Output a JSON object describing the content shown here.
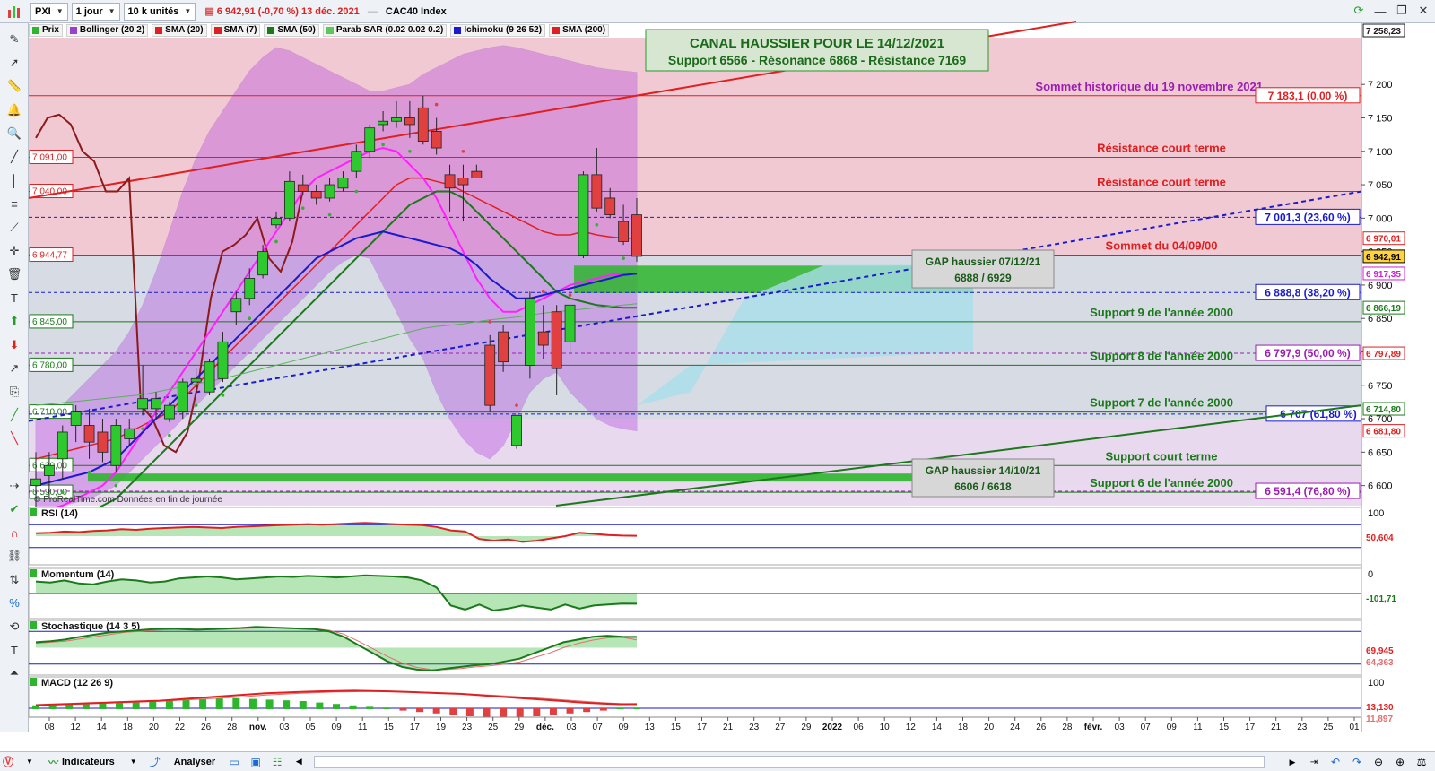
{
  "topbar": {
    "symbol": "PXI",
    "interval": "1 jour",
    "units": "10 k unités",
    "quote": "6 942,91 (-0,70 %) 13 déc. 2021",
    "instrument": "CAC40 Index"
  },
  "indicators": [
    {
      "label": "Prix",
      "color": "#2db52d"
    },
    {
      "label": "Bollinger (20 2)",
      "color": "#9a3fd0"
    },
    {
      "label": "SMA (20)",
      "color": "#e02020"
    },
    {
      "label": "SMA (7)",
      "color": "#e02020"
    },
    {
      "label": "SMA (50)",
      "color": "#1a7a1a"
    },
    {
      "label": "Parab SAR (0.02 0.02 0.2)",
      "color": "#5cc85c"
    },
    {
      "label": "Ichimoku (9 26 52)",
      "color": "#1a1ad0"
    },
    {
      "label": "SMA (200)",
      "color": "#e02020"
    }
  ],
  "toolbar": {
    "tools": [
      "pen-icon",
      "cursor-icon",
      "ruler-icon",
      "alarm-icon",
      "zoom-icon",
      "line-icon",
      "vertical-line-icon",
      "fibonacci-icon",
      "fan-icon",
      "crosshair-icon",
      "trash-icon",
      "text-icon",
      "up-arrow-icon",
      "down-arrow-icon",
      "arrow-icon",
      "copy-icon",
      "trend-up-icon",
      "trend-down-icon",
      "ray-icon",
      "horizontal-ray-icon",
      "check-icon",
      "magnet-icon",
      "link-icon",
      "scale-icon",
      "percent-icon",
      "rewind-icon",
      "text-box-icon",
      "up-icon"
    ]
  },
  "bottombar": {
    "indicators_label": "Indicateurs",
    "analyze_label": "Analyser"
  },
  "colors": {
    "bull": "#2ec92e",
    "bear": "#e04040",
    "resistance": "#e02020",
    "support": "#1a7a1a",
    "fibo": "#1a1ad0",
    "annotation_purple": "#9a1fb0",
    "channel": "#e02020"
  },
  "chart_data": {
    "type": "candlestick",
    "title_box": {
      "line1": "CANAL HAUSSIER POUR LE 14/12/2021",
      "line2": "Support 6566 - Résonance 6868 - Résistance 7169"
    },
    "attribution": "© ProRealTime.com  Données en fin de journée",
    "price_axis": {
      "ylim": [
        6570,
        7270
      ],
      "ticks": [
        6600,
        6650,
        6700,
        6750,
        6800,
        6850,
        6900,
        6950,
        7000,
        7050,
        7100,
        7150,
        7200,
        7258.23
      ],
      "tick_labels": [
        "6 600",
        "6 650",
        "6 700",
        "6 750",
        "6 800",
        "6 850",
        "6 900",
        "6 950",
        "7 000",
        "7 050",
        "7 100",
        "7 150",
        "7 200",
        "7 258,23"
      ],
      "right_badges": [
        {
          "text": "7 258,23",
          "price": 7258.23,
          "color": "#1a1a1a"
        },
        {
          "text": "6 970,01",
          "price": 6970.01,
          "color": "#e02020"
        },
        {
          "text": "6 942,91",
          "price": 6942.91,
          "color": "#000000",
          "bg": "#ffd23f"
        },
        {
          "text": "6 917,35",
          "price": 6917.35,
          "color": "#d020d0"
        },
        {
          "text": "6 866,19",
          "price": 6866.19,
          "color": "#1a7a1a"
        },
        {
          "text": "6 797,89",
          "price": 6797.89,
          "color": "#e02020"
        },
        {
          "text": "6 714,80",
          "price": 6714.8,
          "color": "#1a7a1a"
        },
        {
          "text": "6 681,80",
          "price": 6681.8,
          "color": "#e02020"
        }
      ]
    },
    "x_axis": {
      "tick_labels": [
        "08",
        "12",
        "14",
        "18",
        "20",
        "22",
        "26",
        "28",
        "nov.",
        "03",
        "05",
        "09",
        "11",
        "15",
        "17",
        "19",
        "23",
        "25",
        "29",
        "déc.",
        "03",
        "07",
        "09",
        "13",
        "15",
        "17",
        "21",
        "23",
        "27",
        "29",
        "2022",
        "06",
        "10",
        "12",
        "14",
        "18",
        "20",
        "24",
        "26",
        "28",
        "févr.",
        "03",
        "07",
        "09",
        "11",
        "15",
        "17",
        "21",
        "23",
        "25",
        "01"
      ]
    },
    "horizontal_levels": [
      {
        "price": 7183.1,
        "label": "Sommet historique du 19 novembre 2021",
        "value_label": "7 183,1 (0,00 %)",
        "color": "#e02020"
      },
      {
        "price": 7091.0,
        "left_label": "7 091,00",
        "label": "Résistance court terme",
        "color": "#e02020"
      },
      {
        "price": 7040.0,
        "left_label": "7 040,00",
        "label": "Résistance court terme",
        "color": "#e02020"
      },
      {
        "price": 7001.3,
        "value_label": "7 001,3 (23,60 %)",
        "color": "#1a1ad0",
        "dashed": true
      },
      {
        "price": 6944.77,
        "left_label": "6 944,77",
        "label": "Sommet du 04/09/00",
        "color": "#e02020"
      },
      {
        "price": 6888.8,
        "value_label": "6 888,8 (38,20 %)",
        "color": "#1a1ad0",
        "dashed": true
      },
      {
        "price": 6845.0,
        "left_label": "6 845,00",
        "label": "Support 9 de l'année 2000",
        "color": "#1a7a1a"
      },
      {
        "price": 6797.9,
        "value_label": "6 797,9 (50,00 %)",
        "color": "#9a1fb0",
        "dashed": true
      },
      {
        "price": 6780.0,
        "left_label": "6 780,00",
        "label": "Support 8 de l'année 2000",
        "color": "#1a7a1a"
      },
      {
        "price": 6710.0,
        "left_label": "6 710,00",
        "label": "Support 7 de l'année 2000",
        "color": "#1a7a1a"
      },
      {
        "price": 6707,
        "value_label": "6 707 (61,80 %)",
        "color": "#1a1ad0",
        "dashed": true
      },
      {
        "price": 6630.0,
        "left_label": "6 630,00",
        "label": "Support court terme",
        "color": "#1a7a1a"
      },
      {
        "price": 6590.0,
        "left_label": "6 590,00",
        "label": "Support 6 de l'année 2000",
        "color": "#1a7a1a"
      },
      {
        "price": 6591.4,
        "value_label": "6 591,4 (76,80 %)",
        "color": "#9a1fb0",
        "dashed": true
      }
    ],
    "gaps": [
      {
        "title": "GAP haussier 07/12/21",
        "range": "6888 / 6929",
        "low": 6888,
        "high": 6929
      },
      {
        "title": "GAP haussier 14/10/21",
        "range": "6606 / 6618",
        "low": 6606,
        "high": 6618
      }
    ],
    "candles": [
      {
        "o": 6600,
        "h": 6650,
        "l": 6560,
        "c": 6610
      },
      {
        "o": 6615,
        "h": 6650,
        "l": 6580,
        "c": 6630
      },
      {
        "o": 6640,
        "h": 6690,
        "l": 6610,
        "c": 6680
      },
      {
        "o": 6690,
        "h": 6720,
        "l": 6665,
        "c": 6710
      },
      {
        "o": 6690,
        "h": 6715,
        "l": 6640,
        "c": 6665
      },
      {
        "o": 6680,
        "h": 6700,
        "l": 6635,
        "c": 6650
      },
      {
        "o": 6630,
        "h": 6700,
        "l": 6620,
        "c": 6690
      },
      {
        "o": 6670,
        "h": 6700,
        "l": 6660,
        "c": 6685
      },
      {
        "o": 6715,
        "h": 6780,
        "l": 6705,
        "c": 6730
      },
      {
        "o": 6715,
        "h": 6740,
        "l": 6700,
        "c": 6730
      },
      {
        "o": 6700,
        "h": 6725,
        "l": 6695,
        "c": 6720
      },
      {
        "o": 6710,
        "h": 6760,
        "l": 6700,
        "c": 6755
      },
      {
        "o": 6755,
        "h": 6775,
        "l": 6740,
        "c": 6760
      },
      {
        "o": 6740,
        "h": 6790,
        "l": 6735,
        "c": 6785
      },
      {
        "o": 6760,
        "h": 6830,
        "l": 6755,
        "c": 6815
      },
      {
        "o": 6860,
        "h": 6890,
        "l": 6840,
        "c": 6880
      },
      {
        "o": 6880,
        "h": 6925,
        "l": 6870,
        "c": 6910
      },
      {
        "o": 6915,
        "h": 6960,
        "l": 6910,
        "c": 6950
      },
      {
        "o": 6990,
        "h": 7010,
        "l": 6985,
        "c": 7000
      },
      {
        "o": 7000,
        "h": 7070,
        "l": 6995,
        "c": 7055
      },
      {
        "o": 7050,
        "h": 7065,
        "l": 7035,
        "c": 7040
      },
      {
        "o": 7040,
        "h": 7050,
        "l": 7020,
        "c": 7030
      },
      {
        "o": 7030,
        "h": 7060,
        "l": 7025,
        "c": 7050
      },
      {
        "o": 7045,
        "h": 7070,
        "l": 7040,
        "c": 7060
      },
      {
        "o": 7070,
        "h": 7110,
        "l": 7060,
        "c": 7100
      },
      {
        "o": 7100,
        "h": 7140,
        "l": 7090,
        "c": 7135
      },
      {
        "o": 7140,
        "h": 7160,
        "l": 7130,
        "c": 7145
      },
      {
        "o": 7145,
        "h": 7175,
        "l": 7135,
        "c": 7150
      },
      {
        "o": 7150,
        "h": 7175,
        "l": 7120,
        "c": 7140
      },
      {
        "o": 7165,
        "h": 7183,
        "l": 7110,
        "c": 7115
      },
      {
        "o": 7130,
        "h": 7150,
        "l": 7095,
        "c": 7105
      },
      {
        "o": 7065,
        "h": 7080,
        "l": 7010,
        "c": 7045
      },
      {
        "o": 7060,
        "h": 7080,
        "l": 6995,
        "c": 7050
      },
      {
        "o": 7070,
        "h": 7080,
        "l": 7060,
        "c": 7060
      },
      {
        "o": 6810,
        "h": 6825,
        "l": 6710,
        "c": 6720
      },
      {
        "o": 6830,
        "h": 6840,
        "l": 6770,
        "c": 6785
      },
      {
        "o": 6660,
        "h": 6700,
        "l": 6655,
        "c": 6705
      },
      {
        "o": 6780,
        "h": 6890,
        "l": 6760,
        "c": 6880
      },
      {
        "o": 6830,
        "h": 6870,
        "l": 6790,
        "c": 6810
      },
      {
        "o": 6860,
        "h": 6870,
        "l": 6735,
        "c": 6775
      },
      {
        "o": 6815,
        "h": 6865,
        "l": 6795,
        "c": 6870
      },
      {
        "o": 6945,
        "h": 7070,
        "l": 6940,
        "c": 7065
      },
      {
        "o": 7065,
        "h": 7105,
        "l": 7010,
        "c": 7015
      },
      {
        "o": 7030,
        "h": 7045,
        "l": 7000,
        "c": 7005
      },
      {
        "o": 6995,
        "h": 7020,
        "l": 6960,
        "c": 6965
      },
      {
        "o": 7005,
        "h": 7030,
        "l": 6935,
        "c": 6942.91
      }
    ],
    "sub_panels": [
      {
        "name": "RSI (14)",
        "ylim": [
          0,
          100
        ],
        "tick": "100",
        "last": "50,604",
        "last_color": "#e02020",
        "values": [
          55,
          56,
          58,
          57,
          59,
          60,
          62,
          61,
          63,
          64,
          65,
          66,
          65,
          64,
          66,
          67,
          68,
          69,
          70,
          71,
          70,
          71,
          72,
          73,
          72,
          71,
          70,
          69,
          66,
          60,
          58,
          45,
          42,
          44,
          40,
          42,
          46,
          50,
          56,
          54,
          52,
          51,
          50.6
        ]
      },
      {
        "name": "Momentum (14)",
        "ylim": [
          -250,
          250
        ],
        "tick": "0",
        "last": "-101,71",
        "last_color": "#1a7a1a",
        "values": [
          120,
          110,
          130,
          100,
          90,
          120,
          140,
          130,
          110,
          120,
          150,
          160,
          170,
          160,
          140,
          150,
          160,
          170,
          165,
          175,
          170,
          160,
          170,
          180,
          175,
          170,
          160,
          130,
          60,
          -120,
          -160,
          -110,
          -170,
          -150,
          -120,
          -140,
          -160,
          -110,
          -150,
          -120,
          -110,
          -100,
          -101.71
        ]
      },
      {
        "name": "Stochastique (14 3 5)",
        "ylim": [
          0,
          100
        ],
        "tick": "",
        "last": "69,945",
        "last2": "64,363",
        "last_color": "#e02020",
        "values_k": [
          60,
          62,
          65,
          70,
          74,
          78,
          80,
          82,
          84,
          85,
          84,
          83,
          84,
          85,
          86,
          88,
          87,
          86,
          85,
          84,
          80,
          70,
          55,
          40,
          25,
          15,
          10,
          8,
          12,
          15,
          18,
          20,
          25,
          30,
          40,
          50,
          60,
          65,
          70,
          72,
          70,
          69.9
        ],
        "values_d": [
          58,
          60,
          62,
          66,
          70,
          74,
          78,
          80,
          82,
          83,
          84,
          84,
          83,
          84,
          85,
          86,
          87,
          86,
          85,
          85,
          82,
          75,
          62,
          48,
          34,
          22,
          14,
          10,
          10,
          12,
          15,
          17,
          20,
          24,
          32,
          40,
          50,
          58,
          64,
          68,
          69,
          64.4
        ]
      },
      {
        "name": "MACD (12 26 9)",
        "ylim": [
          0,
          100
        ],
        "tick": "100",
        "last": "13,130",
        "last2": "11,897",
        "last_color": "#e02020",
        "values_macd": [
          10,
          12,
          14,
          16,
          18,
          20,
          22,
          24,
          28,
          32,
          36,
          40,
          44,
          48,
          50,
          52,
          54,
          55,
          56,
          55,
          54,
          52,
          50,
          48,
          46,
          42,
          38,
          34,
          30,
          26,
          22,
          18,
          15,
          13,
          13.1
        ],
        "values_signal": [
          8,
          10,
          12,
          14,
          16,
          18,
          20,
          22,
          25,
          28,
          31,
          34,
          38,
          42,
          45,
          48,
          50,
          52,
          53,
          54,
          54,
          53,
          51,
          49,
          47,
          44,
          41,
          38,
          34,
          30,
          26,
          22,
          18,
          15,
          11.9
        ],
        "values_hist": [
          4,
          5,
          6,
          6,
          7,
          8,
          9,
          10,
          11,
          12,
          13,
          14,
          14,
          13,
          12,
          11,
          10,
          8,
          6,
          4,
          2,
          0,
          -2,
          -4,
          -6,
          -8,
          -10,
          -12,
          -14,
          -12,
          -10,
          -8,
          -6,
          -4,
          -2,
          1,
          1
        ]
      }
    ]
  }
}
